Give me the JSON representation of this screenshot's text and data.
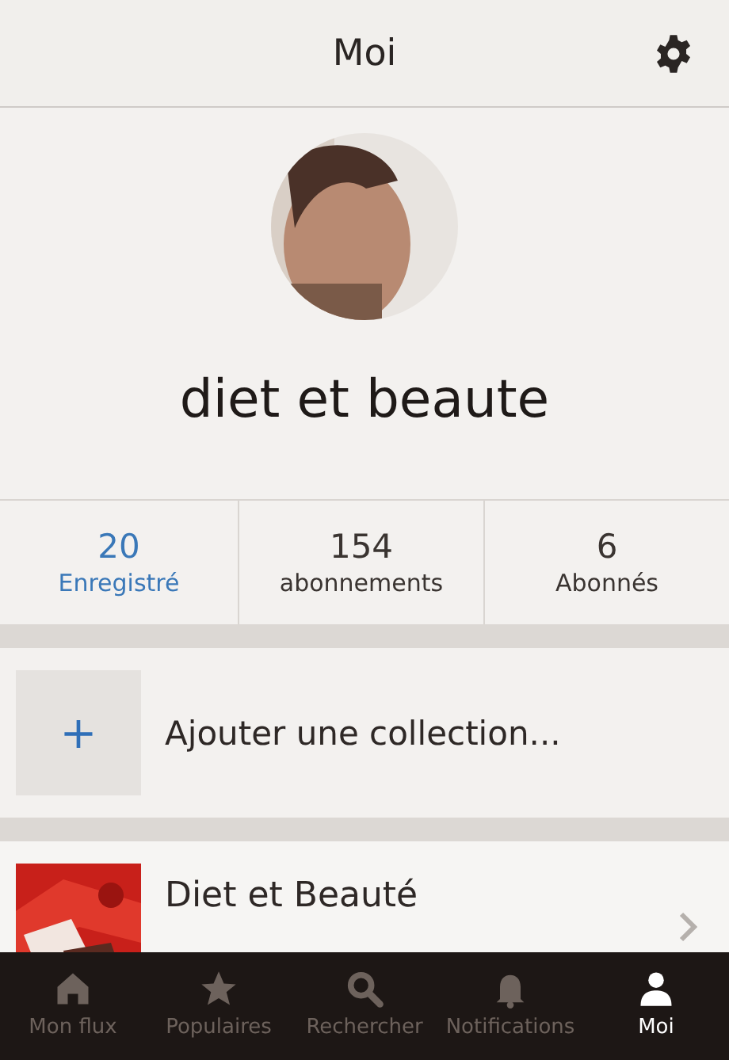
{
  "header": {
    "title": "Moi"
  },
  "profile": {
    "name": "diet et beaute"
  },
  "stats": [
    {
      "value": "20",
      "label": "Enregistré",
      "selected": true
    },
    {
      "value": "154",
      "label": "abonnements",
      "selected": false
    },
    {
      "value": "6",
      "label": "Abonnés",
      "selected": false
    }
  ],
  "add_collection": {
    "symbol": "+",
    "label": "Ajouter une collection..."
  },
  "collections": [
    {
      "title": "Diet et Beauté"
    }
  ],
  "tab_bar": [
    {
      "kind": "home",
      "label": "Mon flux",
      "selected": false
    },
    {
      "kind": "star",
      "label": "Populaires",
      "selected": false
    },
    {
      "kind": "search",
      "label": "Rechercher",
      "selected": false
    },
    {
      "kind": "bell",
      "label": "Notifications",
      "selected": false
    },
    {
      "kind": "person",
      "label": "Moi",
      "selected": true
    }
  ]
}
